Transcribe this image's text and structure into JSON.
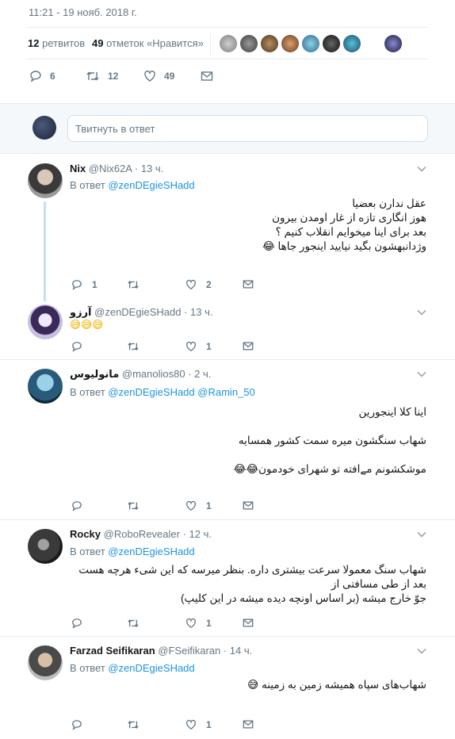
{
  "header": {
    "timestamp": "11:21 - 19 нояб. 2018 г."
  },
  "stats": {
    "retweets_count": "12",
    "retweets_label": "ретвитов",
    "likes_count": "49",
    "likes_label": "отметок «Нравится»"
  },
  "main_actions": {
    "replies": "6",
    "retweets": "12",
    "likes": "49"
  },
  "reply_box": {
    "placeholder": "Твитнуть в ответ"
  },
  "replying_to_label": "В ответ",
  "tweets": [
    {
      "name": "Nix",
      "handle": "@Nix62A",
      "time": "13 ч.",
      "reply_to": "@zenDEgieSHadd",
      "lines": [
        "عقل ندارن بعضیا",
        "هوز انگاری تازه از غار اومدن بیرون",
        "بعد برای اینا میخوایم انقلاب کنیم ؟",
        "وژدانبهشون بگید نیایید اینجور جاها 😂"
      ],
      "replies": "1",
      "retweets": "",
      "likes": "2"
    },
    {
      "name": "آرزو",
      "handle": "@zenDEgieSHadd",
      "time": "13 ч.",
      "reply_to": "",
      "lines": [
        "😅😅😅"
      ],
      "replies": "",
      "retweets": "",
      "likes": "1"
    },
    {
      "name": "مانولیوس",
      "handle": "@manolios80",
      "time": "2 ч.",
      "reply_to": "@zenDEgieSHadd",
      "reply_to_2": "@Ramin_50",
      "lines": [
        "اینا کلا اینجورین",
        "شهاب سنگشون میره سمت کشور همسایه",
        "موشکشونم مےافته تو شهرای خودمون😂😂"
      ],
      "replies": "",
      "retweets": "",
      "likes": "1"
    },
    {
      "name": "Rocky",
      "handle": "@RoboRevealer",
      "time": "12 ч.",
      "reply_to": "@zenDEgieSHadd",
      "lines": [
        "شهاب سنگ معمولا سرعت بیشتری داره. بنظر میرسه که این شیء هرچه هست بعد از طی مسافتی از",
        "جوّ خارج میشه (بر اساس اونچه دیده میشه در این کلیپ)"
      ],
      "replies": "",
      "retweets": "",
      "likes": "1"
    },
    {
      "name": "Farzad Seifikaran",
      "handle": "@FSeifikaran",
      "time": "14 ч.",
      "reply_to": "@zenDEgieSHadd",
      "lines": [
        "شهاب‌های سپاه همیشه زمین به زمینه 😅"
      ],
      "replies": "",
      "retweets": "",
      "likes": "1"
    }
  ],
  "icons": [
    "reply-icon",
    "retweet-icon",
    "like-icon",
    "message-icon",
    "chevron-down-icon"
  ],
  "colors": {
    "link": "#1b95e0",
    "thread_line": "#c3dff5",
    "text_secondary": "#657786"
  }
}
